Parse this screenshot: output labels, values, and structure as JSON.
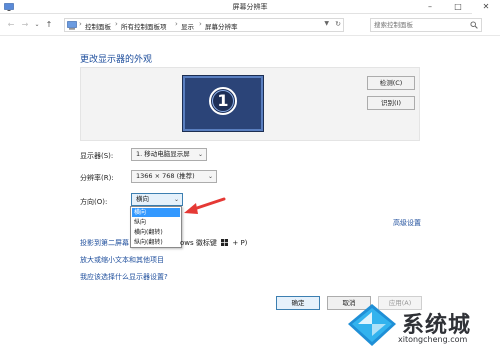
{
  "window": {
    "title": "屏幕分辨率",
    "minimize_icon": "minimize-icon",
    "maximize_icon": "maximize-icon",
    "close_icon": "close-icon"
  },
  "address_bar": {
    "breadcrumbs": [
      "控制面板",
      "所有控制面板项",
      "显示",
      "屏幕分辨率"
    ],
    "search_placeholder": "搜索控制面板"
  },
  "main": {
    "heading": "更改显示器的外观",
    "monitor_number": "1",
    "detect_button": "检测(C)",
    "identify_button": "识别(I)",
    "display_label": "显示器(S):",
    "display_value": "1. 移动电脑显示屏",
    "resolution_label": "分辨率(R):",
    "resolution_value": "1366 × 768 (推荐)",
    "orientation_label": "方向(O):",
    "orientation_value": "横向",
    "orientation_options": [
      "横向",
      "纵向",
      "横向(翻转)",
      "纵向(翻转)"
    ],
    "advanced_link": "高级设置",
    "projector_link_start": "投影到第二屏幕",
    "projector_link_end": "ows 徽标键",
    "projector_link_suffix": "+ P)",
    "text_size_link": "放大或缩小文本和其他项目",
    "which_settings_link": "我应该选择什么显示器设置?"
  },
  "footer": {
    "ok": "确定",
    "cancel": "取消",
    "apply": "应用(A)"
  },
  "watermark": {
    "name": "系统城",
    "url": "xitongcheng.com"
  },
  "colors": {
    "link": "#1e4e9c",
    "selection": "#3399ff",
    "arrow": "#e53935"
  }
}
